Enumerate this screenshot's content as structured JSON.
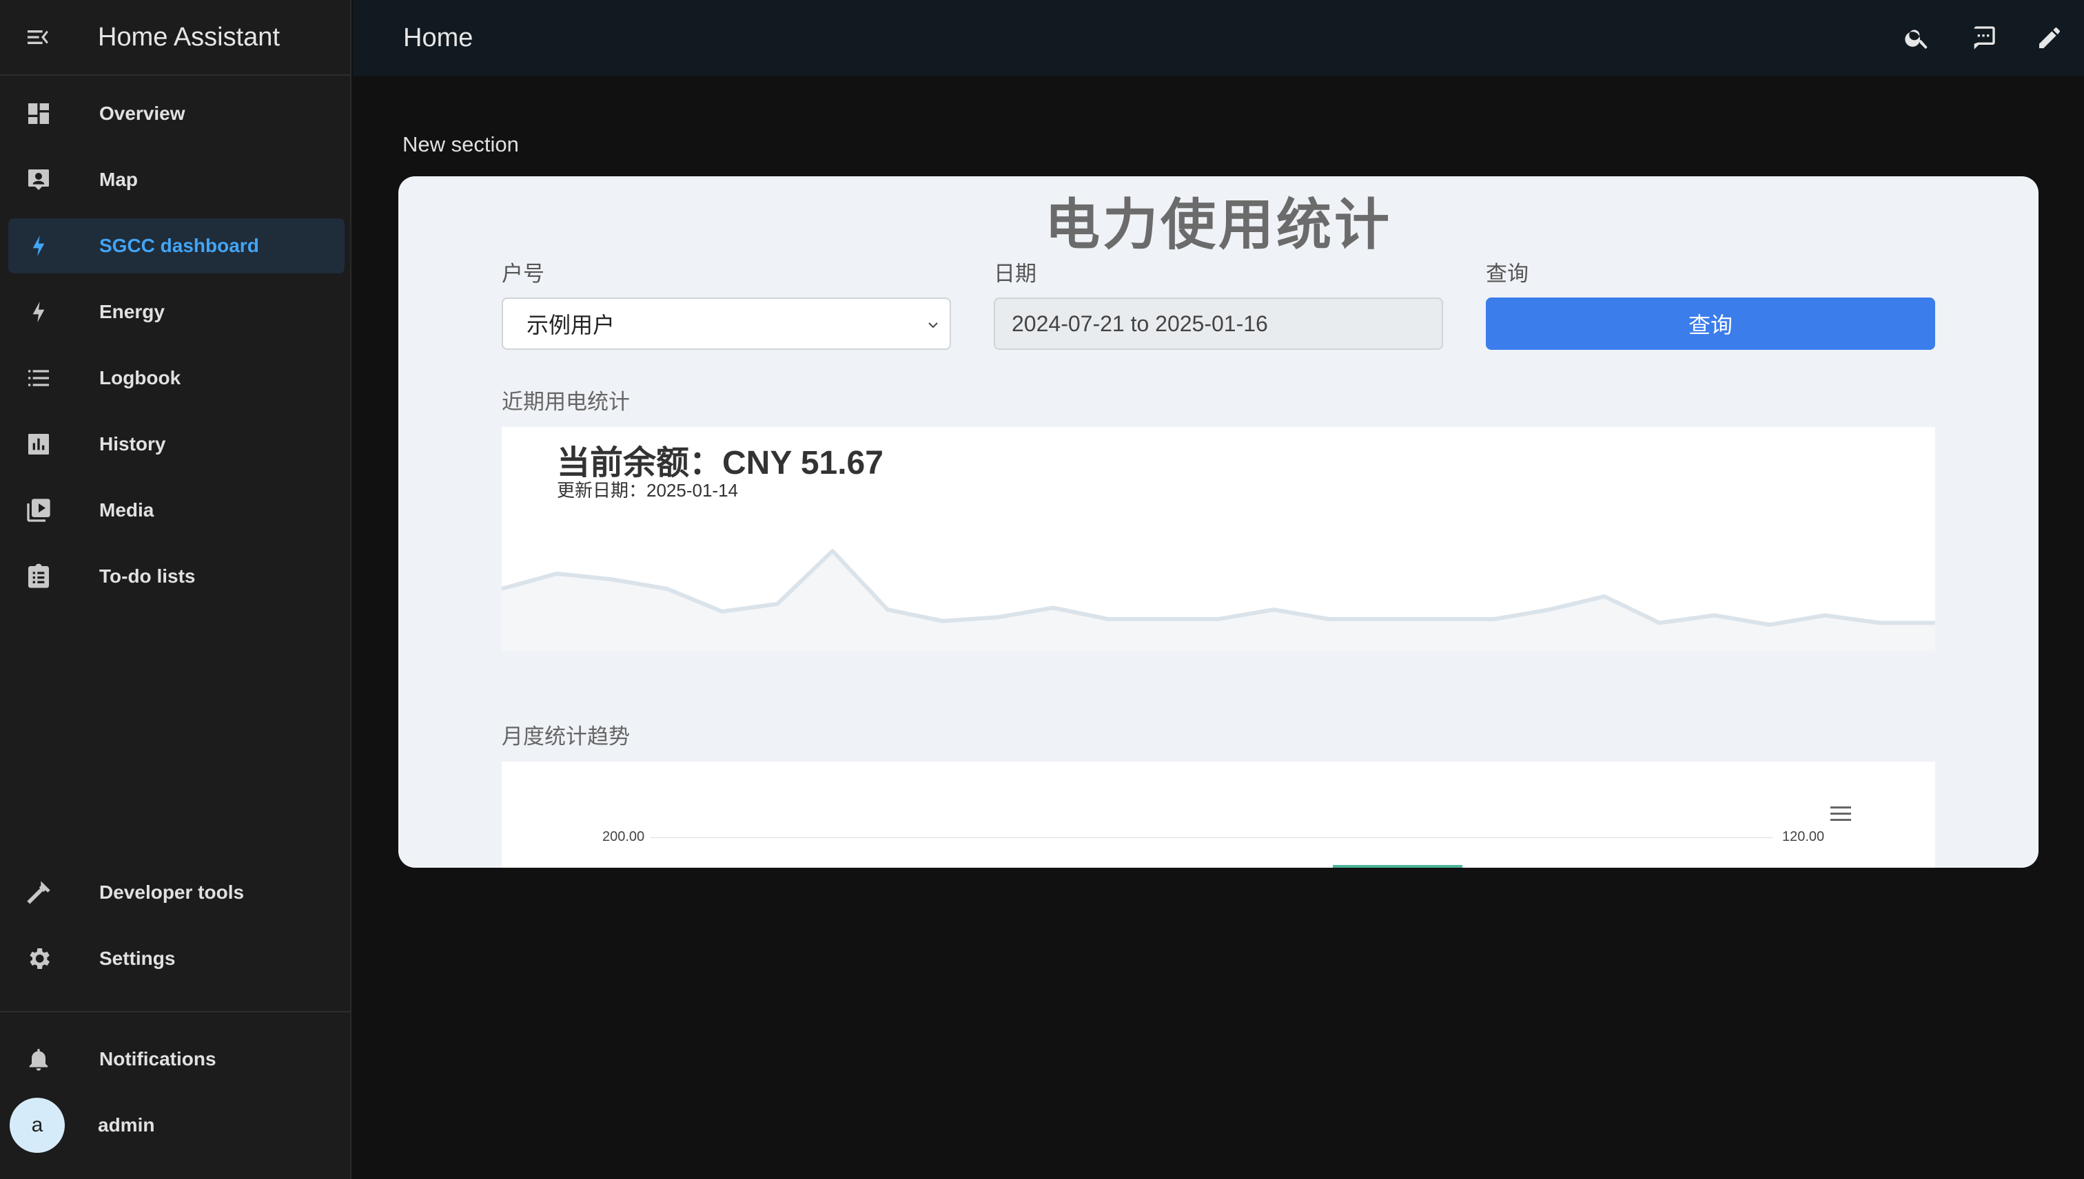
{
  "app": {
    "title": "Home Assistant"
  },
  "sidebar": {
    "items": [
      {
        "label": "Overview",
        "icon": "dashboard-icon"
      },
      {
        "label": "Map",
        "icon": "map-icon"
      },
      {
        "label": "SGCC dashboard",
        "icon": "lightning-bolt-icon",
        "active": true
      },
      {
        "label": "Energy",
        "icon": "lightning-bolt-icon"
      },
      {
        "label": "Logbook",
        "icon": "list-icon"
      },
      {
        "label": "History",
        "icon": "chart-box-icon"
      },
      {
        "label": "Media",
        "icon": "play-box-multiple-icon"
      },
      {
        "label": "To-do lists",
        "icon": "clipboard-list-icon"
      }
    ],
    "bottom": {
      "developer_tools": "Developer tools",
      "settings": "Settings",
      "notifications": "Notifications",
      "user": "admin",
      "avatar_letter": "a"
    }
  },
  "header": {
    "title": "Home"
  },
  "section": {
    "label": "New section"
  },
  "card": {
    "title": "电力使用统计",
    "account_label": "户号",
    "account_value": "示例用户",
    "date_label": "日期",
    "date_value": "2024-07-21 to 2025-01-16",
    "query_label": "查询",
    "query_button": "查询",
    "recent_heading": "近期用电统计",
    "balance_text": "当前余额：CNY 51.67",
    "update_text": "更新日期：2025-01-14",
    "monthly_heading": "月度统计趋势",
    "monthly_left_tick": "200.00",
    "monthly_right_tick": "120.00"
  },
  "chart_data": [
    {
      "type": "area",
      "title": "",
      "values": [
        20,
        28,
        25,
        20,
        8,
        12,
        40,
        9,
        3,
        5,
        10,
        4,
        4,
        4,
        9,
        4,
        4,
        4,
        4,
        9,
        16,
        2,
        6,
        1,
        6,
        2,
        2
      ],
      "color": "#dbe3ea"
    },
    {
      "type": "bar",
      "left_axis_tick": "200.00",
      "right_axis_tick": "120.00",
      "bar_color": "#4db59a"
    }
  ],
  "colors": {
    "accent": "#42a5f5",
    "button": "#3b7deb",
    "card_bg": "#eff2f6"
  }
}
